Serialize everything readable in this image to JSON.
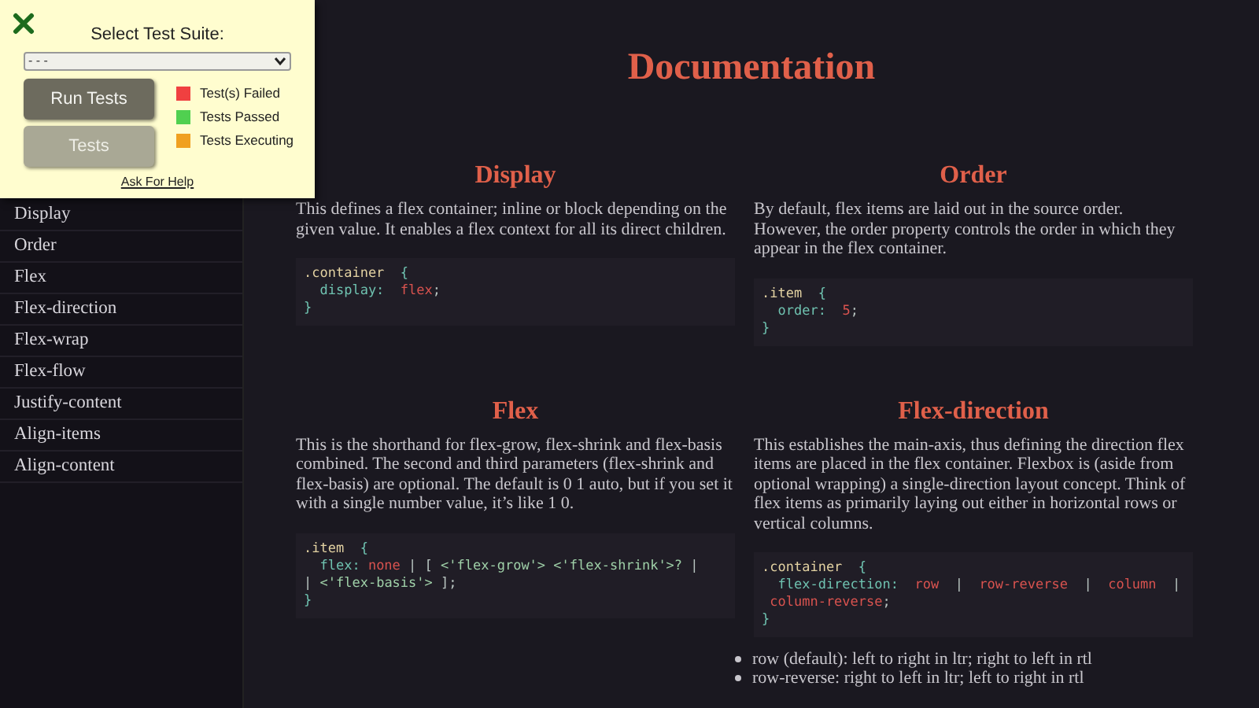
{
  "test_panel": {
    "label": "Select Test Suite:",
    "select_value": "- - -",
    "buttons": [
      {
        "label": "Run Tests",
        "disabled": false
      },
      {
        "label": "Tests",
        "disabled": true
      }
    ],
    "legend": [
      {
        "label": "Test(s) Failed",
        "color": "#f04040"
      },
      {
        "label": "Tests Passed",
        "color": "#50d050"
      },
      {
        "label": "Tests Executing",
        "color": "#f0a020"
      }
    ],
    "help_link": "Ask For Help"
  },
  "sidebar": {
    "items": [
      "Display",
      "Order",
      "Flex",
      "Flex-direction",
      "Flex-wrap",
      "Flex-flow",
      "Justify-content",
      "Align-items",
      "Align-content"
    ]
  },
  "title": "Documentation",
  "sections": [
    {
      "title": "Display",
      "text": "This defines a flex container; inline or block depending on the given value. It enables a flex context for all its direct children.",
      "code": [
        [
          {
            "text": ".container",
            "kind": "selector"
          },
          {
            "text": "  {",
            "kind": "brace"
          }
        ],
        [
          {
            "text": "  display:",
            "kind": "property"
          },
          {
            "text": "  flex",
            "kind": "value"
          },
          {
            "text": ";",
            "kind": "punct"
          }
        ],
        [
          {
            "text": "}",
            "kind": "brace"
          }
        ]
      ]
    },
    {
      "title": "Order",
      "text": "By default, flex items are laid out in the source order. However, the order property controls the order in which they appear in the flex container.",
      "code": [
        [
          {
            "text": ".item",
            "kind": "selector"
          },
          {
            "text": "  {",
            "kind": "brace"
          }
        ],
        [
          {
            "text": "  order:",
            "kind": "property"
          },
          {
            "text": "  5",
            "kind": "value"
          },
          {
            "text": ";",
            "kind": "punct"
          }
        ],
        [
          {
            "text": "}",
            "kind": "brace"
          }
        ]
      ]
    },
    {
      "title": "Flex",
      "text": "This is the shorthand for flex-grow, flex-shrink and flex-basis combined. The second and third parameters (flex-shrink and flex-basis) are optional. The default is 0 1 auto, but if you set it with a single number value, it’s like 1 0.",
      "code": [
        [
          {
            "text": ".item",
            "kind": "selector"
          },
          {
            "text": "  {",
            "kind": "brace"
          }
        ],
        [
          {
            "text": "  flex:",
            "kind": "property"
          },
          {
            "text": " none",
            "kind": "value"
          },
          {
            "text": " | [ ",
            "kind": "punct"
          },
          {
            "text": "<'flex-grow'>",
            "kind": "string"
          },
          {
            "text": " <'flex-shrink'>?",
            "kind": "string"
          },
          {
            "text": " |",
            "kind": "punct"
          }
        ],
        [
          {
            "text": "| ",
            "kind": "punct"
          },
          {
            "text": "<'flex-basis'>",
            "kind": "string"
          },
          {
            "text": " ];",
            "kind": "punct"
          }
        ],
        [
          {
            "text": "}",
            "kind": "brace"
          }
        ]
      ]
    },
    {
      "title": "Flex-direction",
      "text": "This establishes the main-axis, thus defining the direction flex items are placed in the flex container. Flexbox is (aside from optional wrapping) a single-direction layout concept. Think of flex items as primarily laying out either in horizontal rows or vertical columns.",
      "code": [
        [
          {
            "text": ".container",
            "kind": "selector"
          },
          {
            "text": "  {",
            "kind": "brace"
          }
        ],
        [
          {
            "text": "  flex-direction:",
            "kind": "property"
          },
          {
            "text": "  row",
            "kind": "value"
          },
          {
            "text": "  |  ",
            "kind": "punct"
          },
          {
            "text": "row-reverse",
            "kind": "value"
          },
          {
            "text": "  |  ",
            "kind": "punct"
          },
          {
            "text": "column",
            "kind": "value"
          },
          {
            "text": "  |",
            "kind": "punct"
          }
        ],
        [
          {
            "text": " column-reverse",
            "kind": "value"
          },
          {
            "text": ";",
            "kind": "punct"
          }
        ],
        [
          {
            "text": "}",
            "kind": "brace"
          }
        ]
      ],
      "bullets": [
        "row (default): left to right in ltr; right to left in rtl",
        "row-reverse: right to left in ltr; left to right in rtl"
      ]
    }
  ]
}
